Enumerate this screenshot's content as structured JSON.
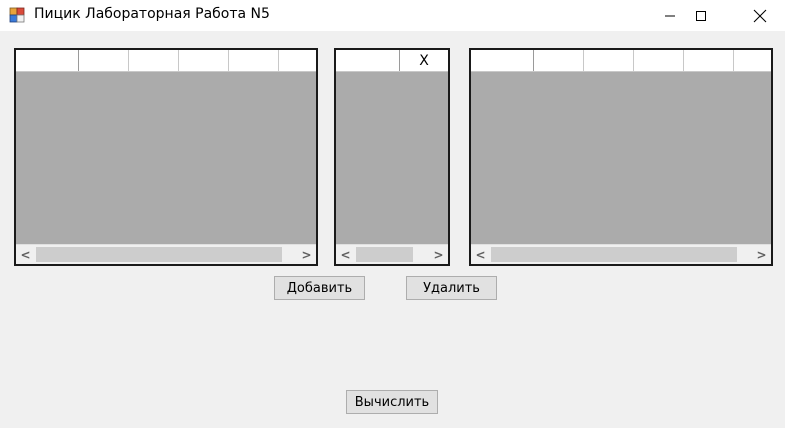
{
  "window": {
    "title": "Пицик Лабораторная Работа N5",
    "icon": "winforms-app-icon",
    "controls": [
      "minimize-icon",
      "maximize-icon",
      "close-icon"
    ]
  },
  "grids": {
    "left": {
      "header_cells": [
        "",
        "",
        "",
        "",
        "",
        ""
      ]
    },
    "middle": {
      "header_cells": [
        "",
        "X"
      ]
    },
    "right": {
      "header_cells": [
        "",
        "",
        "",
        "",
        "",
        ""
      ]
    }
  },
  "buttons": {
    "add": "Добавить",
    "delete": "Удалить",
    "calculate": "Вычислить"
  },
  "colors": {
    "grid_background": "#ababab",
    "window_background": "#f0f0f0",
    "button_background": "#e1e1e1"
  }
}
